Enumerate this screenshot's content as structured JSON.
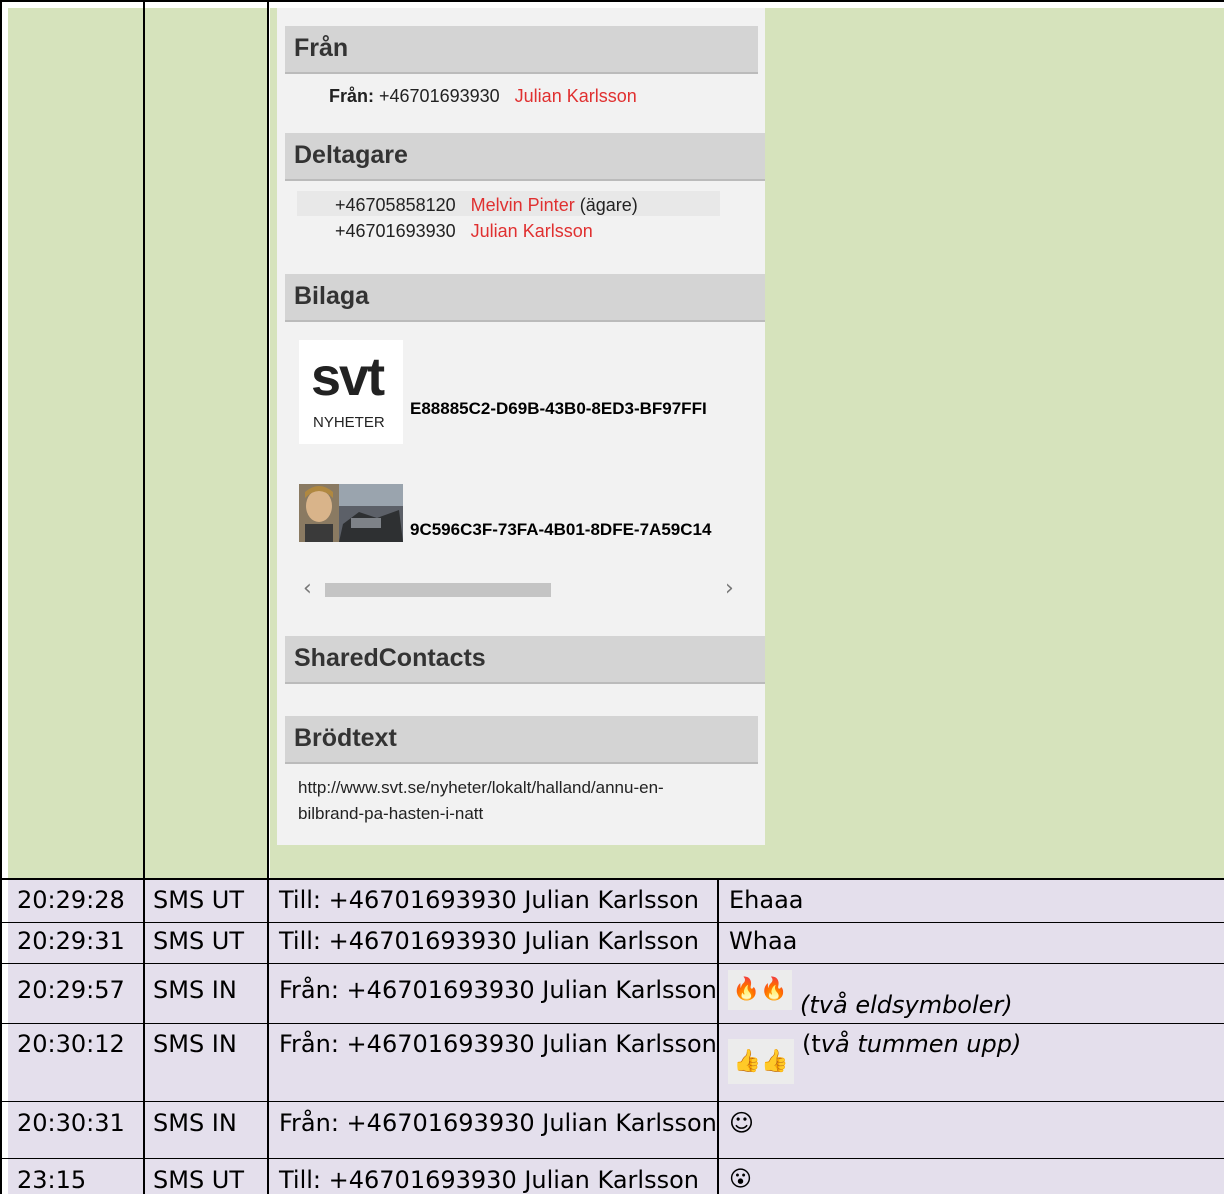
{
  "panel": {
    "from_section": {
      "title": "Från",
      "label": "Från:",
      "number": "+46701693930",
      "name": "Julian Karlsson"
    },
    "participants_section": {
      "title": "Deltagare",
      "rows": [
        {
          "number": "+46705858120",
          "name": "Melvin Pinter",
          "note": "(ägare)"
        },
        {
          "number": "+46701693930",
          "name": "Julian Karlsson",
          "note": ""
        }
      ]
    },
    "attachment_section": {
      "title": "Bilaga",
      "logo_text": "svt",
      "logo_sub": "NYHETER",
      "items": [
        {
          "name": "E88885C2-D69B-43B0-8ED3-BF97FFI"
        },
        {
          "name": "9C596C3F-73FA-4B01-8DFE-7A59C14"
        }
      ],
      "scroll_left": "‹",
      "scroll_right": "›"
    },
    "shared_contacts_section": {
      "title": "SharedContacts"
    },
    "body_section": {
      "title": "Brödtext",
      "line1": "http://www.svt.se/nyheter/lokalt/halland/annu-en-",
      "line2": "bilbrand-pa-hasten-i-natt"
    }
  },
  "rows": [
    {
      "time": "20:29:28",
      "type": "SMS UT",
      "party": "Till: +46701693930 Julian Karlsson",
      "message": "Ehaaa"
    },
    {
      "time": "20:29:31",
      "type": "SMS UT",
      "party": "Till: +46701693930 Julian Karlsson",
      "message": "Whaa"
    },
    {
      "time": "20:29:57",
      "type": "SMS IN",
      "party": "Från: +46701693930 Julian Karlsson",
      "message": "(två eldsymboler)",
      "emoji": "🔥🔥"
    },
    {
      "time": "20:30:12",
      "type": "SMS IN",
      "party": "Från: +46701693930 Julian Karlsson",
      "message_prefix": "(t",
      "message": "vå tummen upp)",
      "emoji": "👍👍"
    },
    {
      "time": "20:30:31",
      "type": "SMS IN",
      "party": "Från: +46701693930 Julian Karlsson",
      "emoji": "☺"
    },
    {
      "time": "23:15",
      "type": "SMS UT",
      "party": "Till: +46701693930 Julian Karlsson",
      "emoji": "😮"
    }
  ],
  "colors": {
    "green_bg": "#d6e3bc",
    "lavender_bg": "#e4dfec",
    "header_gray": "#d4d4d4",
    "name_red": "#e03030"
  }
}
